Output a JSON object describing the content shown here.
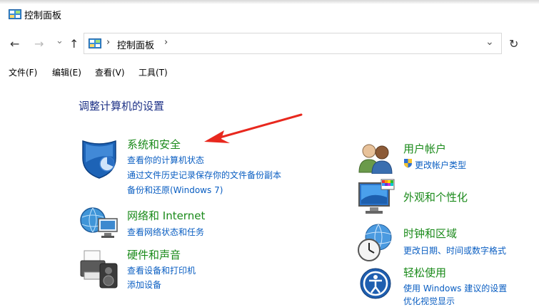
{
  "window": {
    "title": "控制面板"
  },
  "nav": {
    "back_icon": "←",
    "forward_icon": "→",
    "history_icon": "⌄",
    "up_icon": "↑",
    "refresh_icon": "↻"
  },
  "address": {
    "separator": "›",
    "text": "控制面板",
    "dropdown_icon": "⌄"
  },
  "menu": [
    "文件(F)",
    "编辑(E)",
    "查看(V)",
    "工具(T)"
  ],
  "heading": "调整计算机的设置",
  "left_categories": [
    {
      "title": "系统和安全",
      "links": [
        "查看你的计算机状态",
        "通过文件历史记录保存你的文件备份副本",
        "备份和还原(Windows 7)"
      ]
    },
    {
      "title": "网络和 Internet",
      "links": [
        "查看网络状态和任务"
      ]
    },
    {
      "title": "硬件和声音",
      "links": [
        "查看设备和打印机",
        "添加设备"
      ]
    }
  ],
  "right_categories": [
    {
      "title": "用户帐户",
      "links": [
        "更改帐户类型"
      ]
    },
    {
      "title": "外观和个性化",
      "links": []
    },
    {
      "title": "时钟和区域",
      "links": [
        "更改日期、时间或数字格式"
      ]
    },
    {
      "title": "轻松使用",
      "links": [
        "使用 Windows 建议的设置",
        "优化视觉显示"
      ]
    }
  ],
  "colors": {
    "category_title": "#1a8a1a",
    "link": "#0a5ec2",
    "heading": "#1e3287",
    "annotation_arrow": "#e8281e"
  }
}
